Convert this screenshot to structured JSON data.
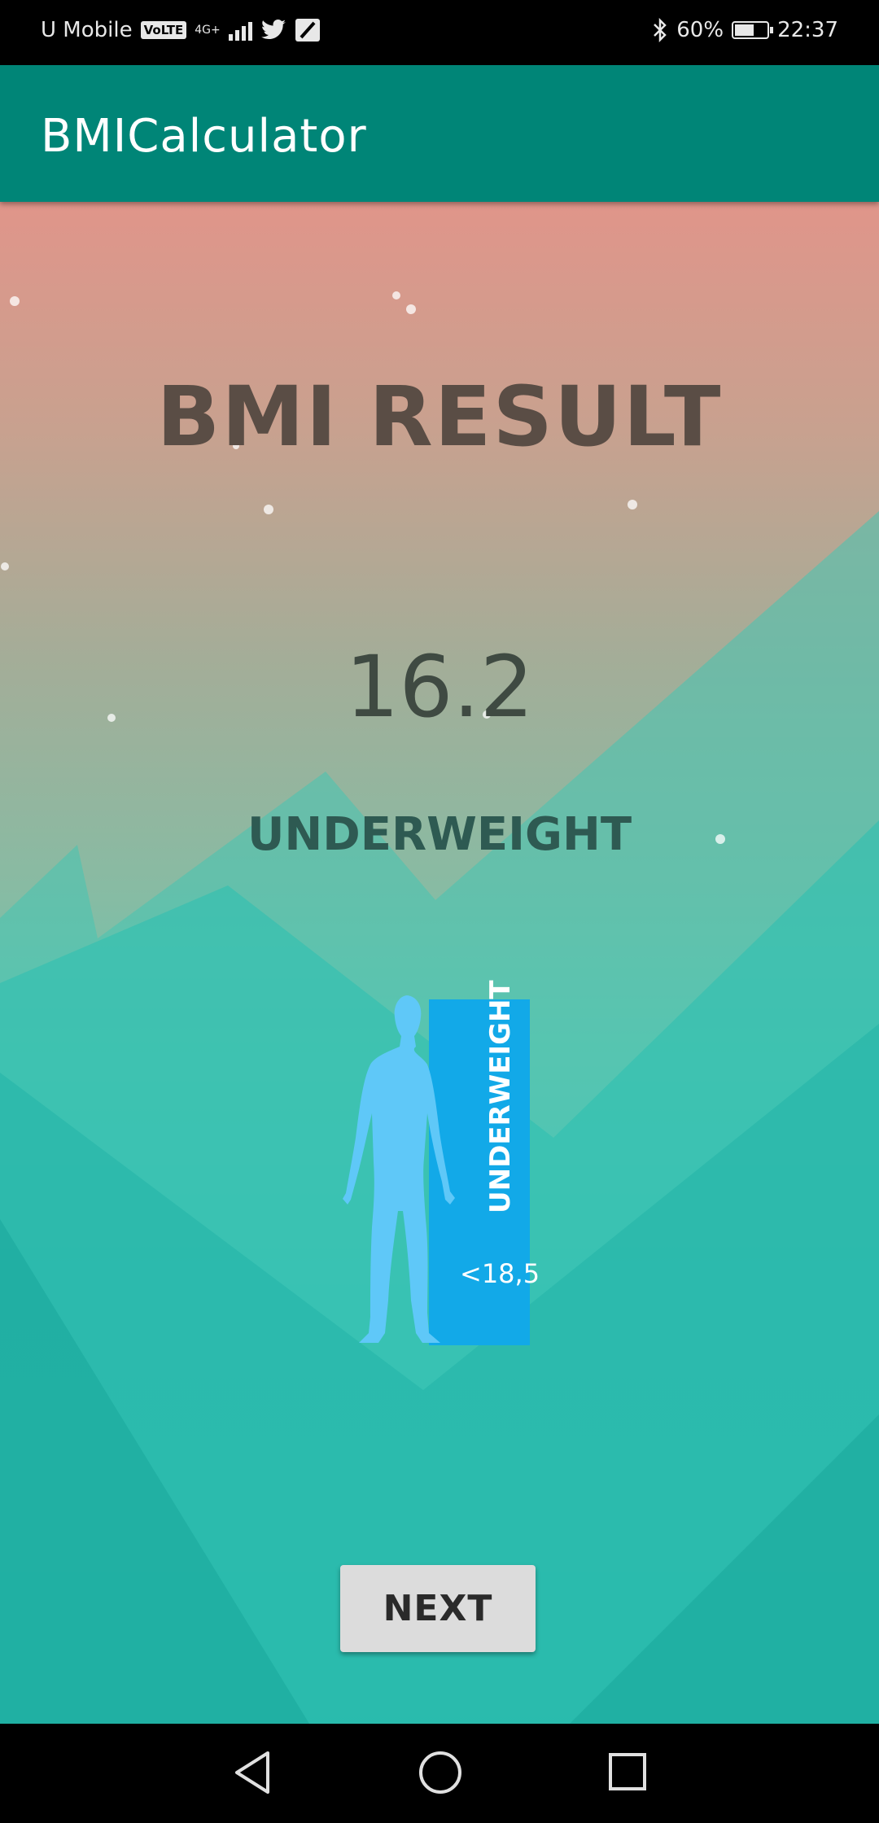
{
  "status_bar": {
    "carrier": "U Mobile",
    "volte": "VoLTE",
    "network": "4G+",
    "bluetooth_icon": "bluetooth-icon",
    "battery_percent": "60%",
    "battery_level": 0.6,
    "time": "22:37"
  },
  "app_bar": {
    "title": "BMICalculator"
  },
  "result": {
    "title": "BMI RESULT",
    "value": "16.2",
    "category": "UNDERWEIGHT"
  },
  "illustration": {
    "range_label": "UNDERWEIGHT",
    "range_threshold": "<18,5",
    "bar_color": "#12a9e8",
    "figure_color": "#5fc8f8"
  },
  "actions": {
    "next_label": "NEXT"
  },
  "colors": {
    "app_bar": "#008577",
    "title_text": "#5a4d45",
    "category_text": "#2e5a52"
  }
}
